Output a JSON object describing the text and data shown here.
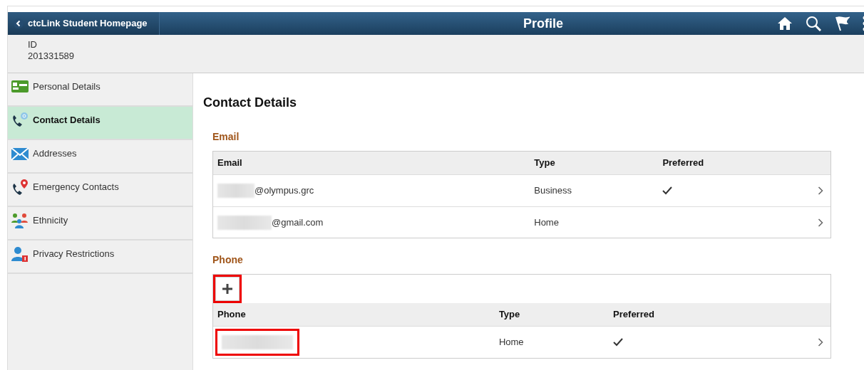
{
  "header": {
    "back_label": "ctcLink Student Homepage",
    "title": "Profile"
  },
  "id_bar": {
    "label": "ID",
    "value": "201331589"
  },
  "sidebar": {
    "items": [
      {
        "label": "Personal Details",
        "selected": false
      },
      {
        "label": "Contact Details",
        "selected": true
      },
      {
        "label": "Addresses",
        "selected": false
      },
      {
        "label": "Emergency Contacts",
        "selected": false
      },
      {
        "label": "Ethnicity",
        "selected": false
      },
      {
        "label": "Privacy Restrictions",
        "selected": false
      }
    ]
  },
  "content": {
    "title": "Contact Details",
    "sections": [
      {
        "title": "Email",
        "columns": [
          "Email",
          "Type",
          "Preferred"
        ],
        "rows": [
          {
            "value": "@olympus.grc",
            "redacted": true,
            "highlighted": false,
            "type": "Business",
            "preferred": true
          },
          {
            "value": "@gmail.com",
            "redacted": true,
            "highlighted": false,
            "type": "Home",
            "preferred": false
          }
        ]
      },
      {
        "title": "Phone",
        "add_button": {
          "highlighted": true
        },
        "columns": [
          "Phone",
          "Type",
          "Preferred"
        ],
        "rows": [
          {
            "redacted": true,
            "highlighted": true,
            "type": "Home",
            "preferred": true
          }
        ]
      }
    ]
  }
}
